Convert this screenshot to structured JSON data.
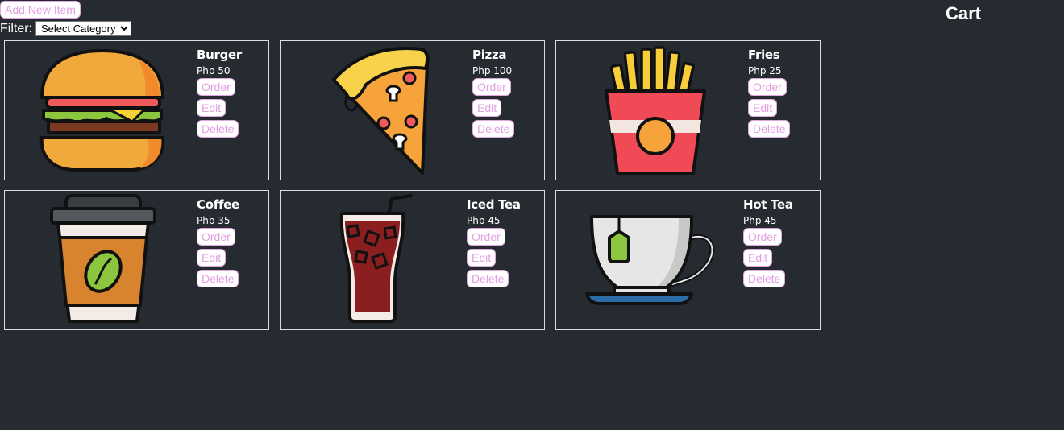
{
  "toolbar": {
    "add_label": "Add New Item",
    "filter_label": "Filter:",
    "filter_selected": "Select Category"
  },
  "cart": {
    "title": "Cart"
  },
  "menu": {
    "items": [
      {
        "name": "Burger",
        "price": "Php 50",
        "icon": "burger-icon"
      },
      {
        "name": "Pizza",
        "price": "Php 100",
        "icon": "pizza-slice-icon"
      },
      {
        "name": "Fries",
        "price": "Php 25",
        "icon": "fries-icon"
      },
      {
        "name": "Coffee",
        "price": "Php 35",
        "icon": "coffee-cup-icon"
      },
      {
        "name": "Iced Tea",
        "price": "Php 45",
        "icon": "iced-tea-glass-icon"
      },
      {
        "name": "Hot Tea",
        "price": "Php 45",
        "icon": "tea-cup-icon"
      }
    ],
    "order_label": "Order",
    "edit_label": "Edit",
    "delete_label": "Delete"
  },
  "colors": {
    "background": "#262a31",
    "button_text": "#e2a0e2",
    "card_border": "#dcdcdc"
  }
}
